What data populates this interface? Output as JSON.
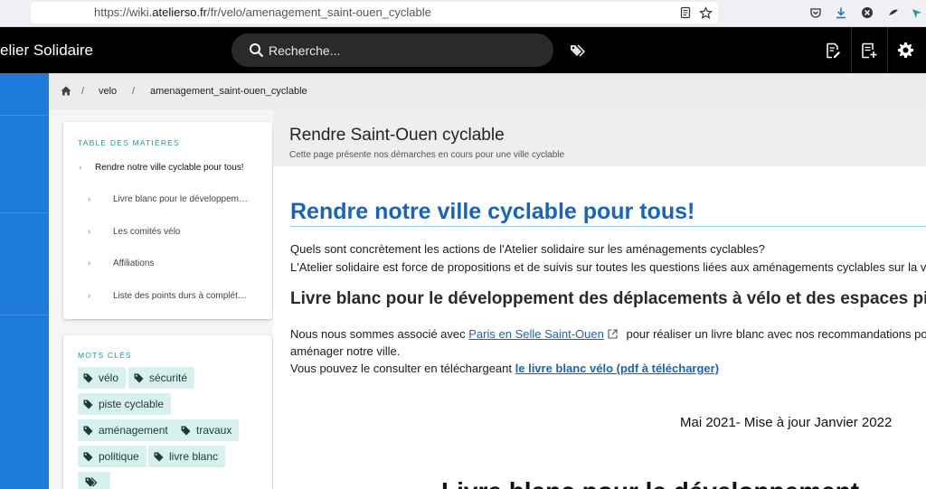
{
  "browser": {
    "url_prefix": "https://wiki.",
    "url_domain": "atelierso.fr",
    "url_path": "/fr/velo/amenagement_saint-ouen_cyclable"
  },
  "header": {
    "brand": "elier Solidaire",
    "search_placeholder": "Recherche..."
  },
  "breadcrumb": {
    "items": [
      "velo",
      "amenagement_saint-ouen_cyclable"
    ],
    "separator": "/"
  },
  "toc": {
    "title": "TABLE DES MATIÈRES",
    "items": [
      {
        "label": "Rendre notre ville cyclable pour tous!",
        "level": 1
      },
      {
        "label": "Livre blanc pour le développem…",
        "level": 2
      },
      {
        "label": "Les comités vélo",
        "level": 2
      },
      {
        "label": "Affiliations",
        "level": 2
      },
      {
        "label": "Liste des points durs à complét…",
        "level": 2
      }
    ]
  },
  "tags": {
    "title": "MOTS CLÉS",
    "items": [
      "vélo",
      "sécurité",
      "piste cyclable",
      "aménagement",
      "travaux",
      "politique",
      "livre blanc"
    ]
  },
  "page": {
    "title": "Rendre Saint-Ouen cyclable",
    "subtitle": "Cette page présente nos démarches en cours pour une ville cyclable"
  },
  "content": {
    "h1": "Rendre notre ville cyclable pour tous!",
    "p1_line1": "Quels sont concrètement les actions de l'Atelier solidaire sur les aménagements cyclables?",
    "p1_line2": "L'Atelier solidaire est force de propositions et de suivis sur toutes les questions liées aux aménagements cyclables sur la vil",
    "h2": "Livre blanc pour le développement des déplacements à vélo et des espaces piéto",
    "p2_before": "Nous nous sommes associé avec ",
    "p2_link": "Paris en Selle Saint-Ouen",
    "p2_after": " pour réaliser un livre blanc avec nos recommandations pour",
    "p2_line2": "aménager notre ville.",
    "p3_before": "Vous pouvez le consulter en téléchargeant ",
    "p3_link": "le livre blanc vélo (pdf à télécharger)",
    "image_caption": "Mai 2021- Mise à jour Janvier 2022",
    "image_partial_title": "Livre blanc pour le développement"
  },
  "colors": {
    "accent": "#1565c0",
    "rail": "#1e7bd9",
    "tag_bg": "#d8f0ee",
    "teal": "#1b9a9a"
  }
}
